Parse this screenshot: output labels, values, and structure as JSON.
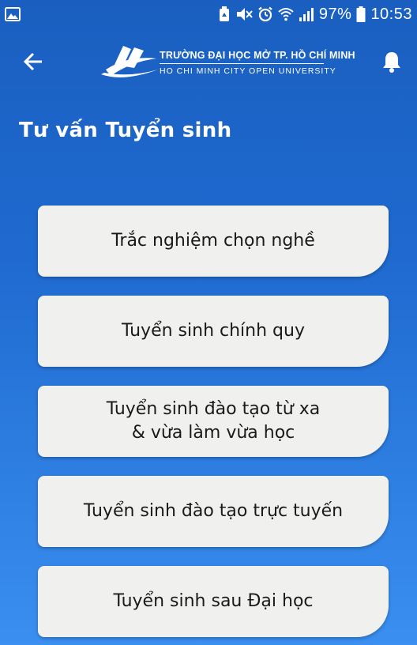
{
  "status_bar": {
    "battery_percent": "97%",
    "time": "10:53",
    "icons": [
      "image-icon",
      "recycle-icon",
      "mute-icon",
      "alarm-icon",
      "wifi-icon",
      "signal-icon",
      "battery-icon"
    ]
  },
  "header": {
    "back_icon": "arrow-left-icon",
    "bell_icon": "bell-icon",
    "logo_line1": "TRƯỜNG ĐẠI HỌC MỞ TP. HỒ CHÍ MINH",
    "logo_line2": "HO CHI MINH CITY OPEN UNIVERSITY"
  },
  "page": {
    "title": "Tư vấn Tuyển sinh"
  },
  "menu": {
    "items": [
      {
        "label": "Trắc nghiệm chọn nghề"
      },
      {
        "label": "Tuyển sinh chính quy"
      },
      {
        "label": "Tuyển sinh đào tạo từ xa\n& vừa làm vừa học"
      },
      {
        "label": "Tuyển sinh đào tạo trực tuyến"
      },
      {
        "label": "Tuyển sinh sau Đại học"
      }
    ]
  },
  "colors": {
    "background_top": "#1a5fc0",
    "background_bottom": "#3a8ff0",
    "card": "#f0f0ee",
    "card_text": "#1a1a1a"
  }
}
